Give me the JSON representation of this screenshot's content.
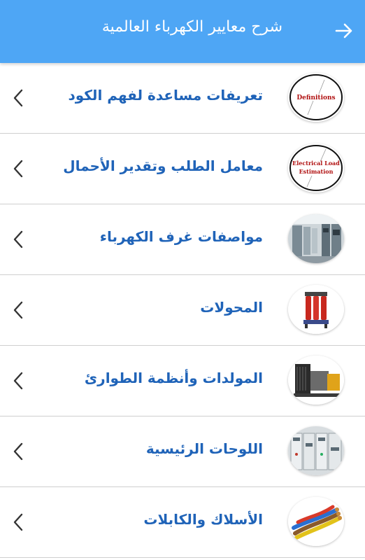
{
  "header": {
    "title": "شرح معايير الكهرباء العالمية",
    "back_icon": "arrow-right-icon",
    "color": "#4ea6f5"
  },
  "list": {
    "label_color": "#1f63b8",
    "items": [
      {
        "label": "تعريفات مساعدة لفهم الكود",
        "thumb_text": "Definitions",
        "chevron_icon": "chevron-left-icon"
      },
      {
        "label": "معامل الطلب وتقدير الأحمال",
        "thumb_text_1": "Electrical Load",
        "thumb_text_2": "Estimation",
        "chevron_icon": "chevron-left-icon"
      },
      {
        "label": "مواصفات غرف الكهرباء",
        "thumb_icon": "switchgear-room-image",
        "chevron_icon": "chevron-left-icon"
      },
      {
        "label": "المحولات",
        "thumb_icon": "transformer-image",
        "chevron_icon": "chevron-left-icon"
      },
      {
        "label": "المولدات وأنظمة الطوارئ",
        "thumb_icon": "generator-image",
        "chevron_icon": "chevron-left-icon"
      },
      {
        "label": "اللوحات الرئيسية",
        "thumb_icon": "main-panels-image",
        "chevron_icon": "chevron-left-icon"
      },
      {
        "label": "الأسلاك والكابلات",
        "thumb_icon": "cables-image",
        "chevron_icon": "chevron-left-icon"
      }
    ]
  }
}
